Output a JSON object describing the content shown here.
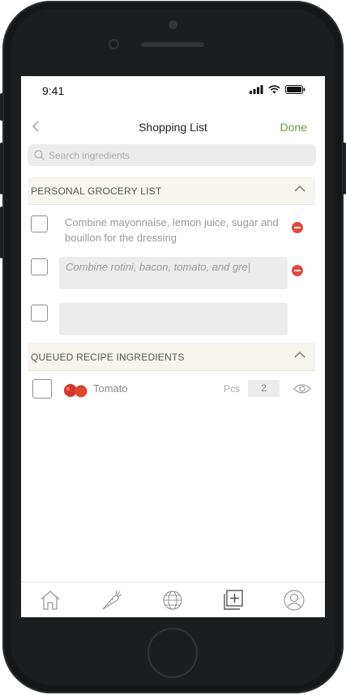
{
  "status_bar": {
    "time": "9:41"
  },
  "nav": {
    "title": "Shopping List",
    "done_label": "Done"
  },
  "search": {
    "placeholder": "Search ingredients",
    "value": ""
  },
  "personal_section": {
    "title": "PERSONAL GROCERY LIST",
    "items": [
      {
        "text": "Combine mayonnaise, lemon juice, sugar and bouillon for the dressing"
      },
      {
        "input_value": "Combine rotini, bacon, tomato, and gre|"
      },
      {
        "input_value": ""
      }
    ]
  },
  "queued_section": {
    "title": "QUEUED RECIPE INGREDIENTS",
    "items": [
      {
        "name": "Tomato",
        "unit": "Pcs",
        "quantity": "2",
        "icon": "tomato-icon"
      }
    ]
  },
  "tab_bar": {
    "tabs": [
      "home-icon",
      "carrot-icon",
      "globe-icon",
      "add-to-list-icon",
      "profile-icon"
    ]
  },
  "colors": {
    "accent": "#6e9d3a",
    "remove": "#e04a3c",
    "section_bg": "#f6f5ee"
  }
}
